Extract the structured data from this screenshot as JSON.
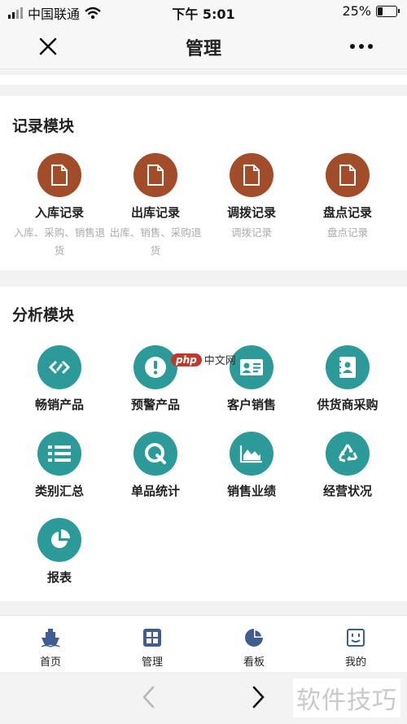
{
  "status": {
    "carrier": "中国联通",
    "time": "下午 5:01",
    "battery": "25%",
    "battery_level": 0.25
  },
  "nav": {
    "title": "管理"
  },
  "record_module": {
    "title": "记录模块",
    "items": [
      {
        "label": "入库记录",
        "desc": "入库、采购、销售退货"
      },
      {
        "label": "出库记录",
        "desc": "出库、销售、采购退货"
      },
      {
        "label": "调拨记录",
        "desc": "调拨记录"
      },
      {
        "label": "盘点记录",
        "desc": "盘点记录"
      }
    ]
  },
  "analysis_module": {
    "title": "分析模块",
    "items": [
      {
        "label": "畅销产品",
        "icon": "link-icon"
      },
      {
        "label": "预警产品",
        "icon": "alert-icon"
      },
      {
        "label": "客户销售",
        "icon": "id-card-icon"
      },
      {
        "label": "供货商采购",
        "icon": "contact-book-icon"
      },
      {
        "label": "类别汇总",
        "icon": "list-icon"
      },
      {
        "label": "单品统计",
        "icon": "q-icon"
      },
      {
        "label": "销售业绩",
        "icon": "area-chart-icon"
      },
      {
        "label": "经营状况",
        "icon": "recycle-icon"
      },
      {
        "label": "报表",
        "icon": "pie-chart-icon"
      }
    ]
  },
  "watermark": {
    "php": "php",
    "site": "中文网",
    "corner": "软件技巧"
  },
  "tabs": [
    {
      "label": "首页",
      "icon": "ship-icon"
    },
    {
      "label": "管理",
      "icon": "grid-icon"
    },
    {
      "label": "看板",
      "icon": "pie-icon"
    },
    {
      "label": "我的",
      "icon": "face-icon"
    }
  ],
  "colors": {
    "record_icon": "#a24c2a",
    "analysis_icon": "#2c9a99",
    "tab_icon": "#3f5d8f"
  }
}
